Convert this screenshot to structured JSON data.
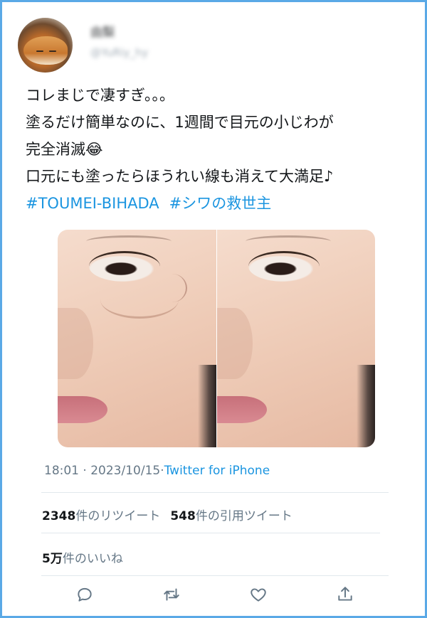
{
  "user": {
    "name": "由梨",
    "handle": "@YuRiy_hy"
  },
  "tweet": {
    "lines": [
      "コレまじで凄すぎ。。。",
      "塗るだけ簡単なのに、1週間で目元の小じわが",
      "完全消滅😂",
      "口元にも塗ったらほうれい線も消えて大満足♪"
    ],
    "hashtags": [
      "#TOUMEI-BIHADA",
      "#シワの救世主"
    ]
  },
  "meta": {
    "time": "18:01",
    "separator": " · ",
    "date": "2023/10/15",
    "separator2": "·",
    "source": "Twitter for iPhone"
  },
  "stats": {
    "retweets_count": "2348",
    "retweets_label": "件のリツイート",
    "quotes_count": "548",
    "quotes_label": "件の引用ツイート",
    "likes_count": "5万",
    "likes_label": "件のいいね"
  },
  "icons": {
    "reply": "reply-icon",
    "retweet": "retweet-icon",
    "like": "like-icon",
    "share": "share-icon"
  },
  "colors": {
    "link": "#1b95e0",
    "frame": "#5aa9e6",
    "text": "#14171a",
    "muted": "#657786"
  }
}
